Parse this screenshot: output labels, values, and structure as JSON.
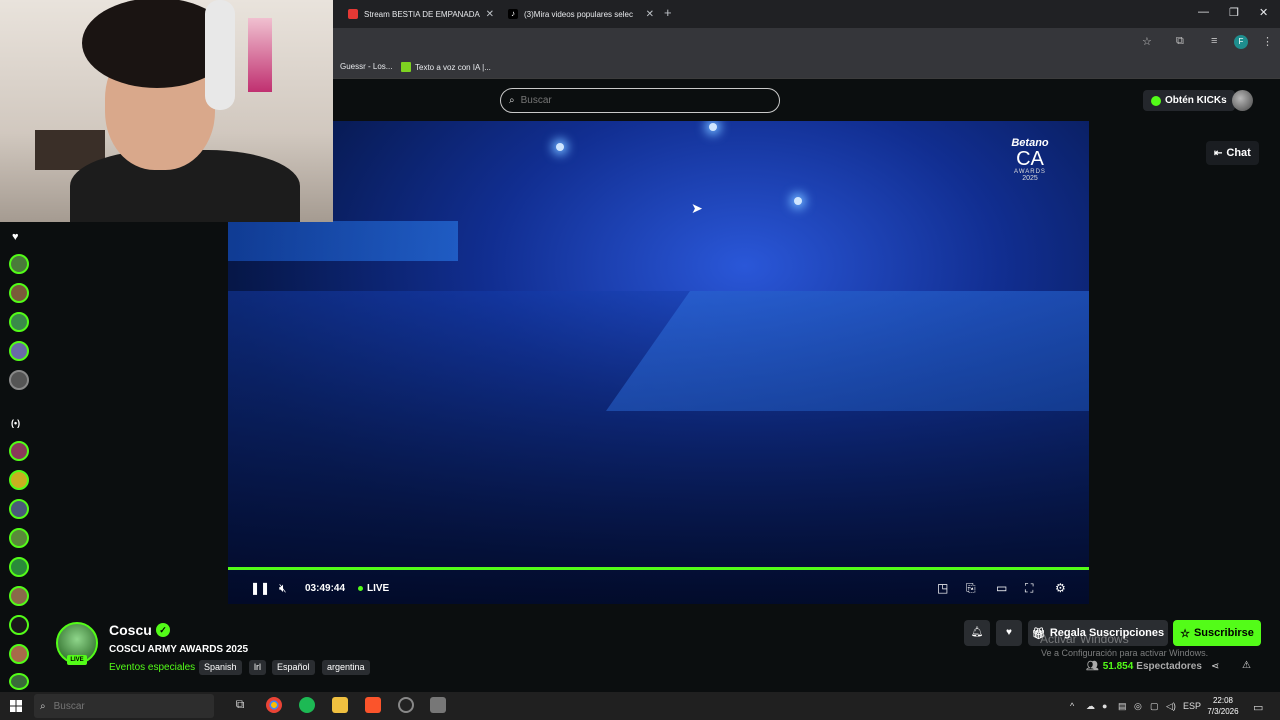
{
  "browser": {
    "tabs": [
      {
        "label": "Stream BESTIA DE EMPANADA"
      },
      {
        "label": "(3)Mira videos populares selec"
      }
    ],
    "bookmarks": [
      {
        "label": "Guessr - Los..."
      },
      {
        "label": "Texto a voz con IA |..."
      }
    ]
  },
  "site": {
    "search_placeholder": "Buscar",
    "kicks_label": "Obtén KICKs",
    "chat_label": "Chat"
  },
  "player": {
    "timecode": "03:49:44",
    "live_label": "LIVE",
    "progress": 1.0,
    "overlay_logo": {
      "brand": "Betano",
      "ca": "CA",
      "awards": "AWARDS",
      "year": "2025"
    }
  },
  "channel": {
    "name": "Coscu",
    "live_badge": "LIVE",
    "stream_title": "COSCU ARMY AWARDS 2025",
    "category": "Eventos especiales",
    "tags": [
      "Spanish",
      "lrl",
      "Español",
      "argentina"
    ],
    "gift_label": "Regala Suscripciones",
    "subscribe_label": "Suscribirse",
    "viewer_count": "51.854",
    "viewer_label": "Espectadores"
  },
  "windows_notice": {
    "line1": "Activar Windows",
    "line2": "Ve a Configuración para activar Windows."
  },
  "taskbar": {
    "search_placeholder": "Buscar",
    "language": "ESP",
    "time": "22:08",
    "date": "7/3/2026"
  },
  "colors": {
    "accent": "#53fc18",
    "background": "#0b0e0f",
    "button": "#2a2d31"
  }
}
